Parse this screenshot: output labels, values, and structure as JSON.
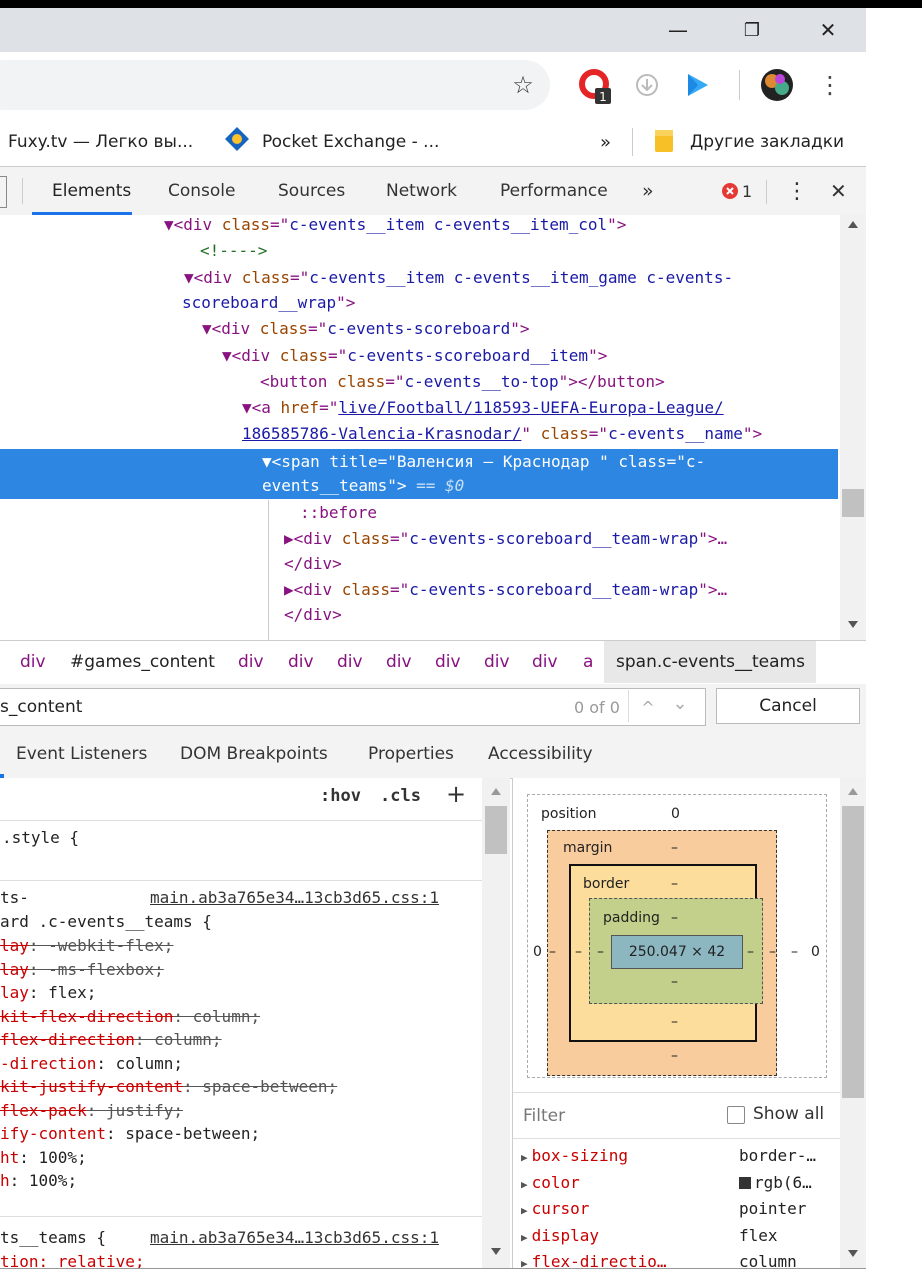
{
  "window": {
    "minimize": "—",
    "restore": "❐",
    "close": "✕"
  },
  "toolbar": {
    "star": "☆",
    "menu": "⋮",
    "ext_badge": "1"
  },
  "bookmarks": {
    "item1": "Fuxy.tv — Легко вы...",
    "item2": "Pocket Exchange - ...",
    "overflow": "»",
    "other": "Другие закладки"
  },
  "devtools": {
    "tabs": [
      "Elements",
      "Console",
      "Sources",
      "Network",
      "Performance"
    ],
    "more": "»",
    "error_count": "1",
    "menu": "⋮",
    "close": "✕"
  },
  "dom": {
    "l1": {
      "open": "▼<div ",
      "attr": "class",
      "eq": "=\"",
      "val": "c-events__item c-events__item_col",
      "close": "\">"
    },
    "l2": "<!---->",
    "l3": {
      "open": "▼<div ",
      "attr": "class",
      "eq": "=\"",
      "val": "c-events__item c-events__item_game c-events-"
    },
    "l4": {
      "val": "scoreboard__wrap",
      "close": "\">"
    },
    "l5": {
      "open": "▼<div ",
      "attr": "class",
      "eq": "=\"",
      "val": "c-events-scoreboard",
      "close": "\">"
    },
    "l6": {
      "open": "▼<div ",
      "attr": "class",
      "eq": "=\"",
      "val": "c-events-scoreboard__item",
      "close": "\">"
    },
    "l7": {
      "open": "<button ",
      "attr": "class",
      "eq": "=\"",
      "val": "c-events__to-top",
      "close": "\"></button>"
    },
    "l8": {
      "open": "▼<a ",
      "attr": "href",
      "eq": "=\"",
      "link": "live/Football/118593-UEFA-Europa-League/"
    },
    "l9": {
      "link": "186585786-Valencia-Krasnodar/",
      "q": "\" ",
      "attr": "class",
      "eq": "=\"",
      "val": "c-events__name",
      "close": "\">"
    },
    "l10": "▼<span title=\"Валенсия — Краснодар  \" class=\"c-",
    "l11a": "events__teams\">",
    "l11b": " == $0",
    "l12": "::before",
    "l13": {
      "open": "▶<div ",
      "attr": "class",
      "eq": "=\"",
      "val": "c-events-scoreboard__team-wrap",
      "close": "\">…"
    },
    "l14": "</div>",
    "l15": {
      "open": "▶<div ",
      "attr": "class",
      "eq": "=\"",
      "val": "c-events-scoreboard__team-wrap",
      "close": "\">…"
    },
    "l16": "</div>"
  },
  "breadcrumbs": [
    "div",
    "#games_content",
    "div",
    "div",
    "div",
    "div",
    "div",
    "div",
    "div",
    "a",
    "span.c-events__teams"
  ],
  "find": {
    "value": "s_content",
    "count": "0 of 0",
    "up": "^",
    "down": "⌄",
    "cancel": "Cancel"
  },
  "subtabs": [
    "Event Listeners",
    "DOM Breakpoints",
    "Properties",
    "Accessibility"
  ],
  "styles": {
    "hov": ":hov",
    "cls": ".cls",
    "plus": "+",
    "element_style": ".style {",
    "rule1_sel_a": "ts-",
    "rule1_src": "main.ab3a765e34…13cb3d65.css:1",
    "rule1_sel_b": "ard .c-events__teams {",
    "decls": [
      {
        "p": "lay",
        "v": ": -webkit-flex;",
        "strike": true
      },
      {
        "p": "lay",
        "v": ": -ms-flexbox;",
        "strike": true
      },
      {
        "p": "lay",
        "v": ": flex;",
        "strike": false
      },
      {
        "p": "kit-flex-direction",
        "v": ": column;",
        "strike": true
      },
      {
        "p": "flex-direction",
        "v": ": column;",
        "strike": true
      },
      {
        "p": "-direction",
        "v": ": column;",
        "strike": false
      },
      {
        "p": "kit-justify-content",
        "v": ": space-between;",
        "strike": true
      },
      {
        "p": "flex-pack",
        "v": ": justify;",
        "strike": true
      },
      {
        "p": "ify-content",
        "v": ": space-between;",
        "strike": false
      },
      {
        "p": "ht",
        "v": ": 100%;",
        "strike": false
      },
      {
        "p": "h",
        "v": ": 100%;",
        "strike": false
      }
    ],
    "rule2_sel": "ts__teams {",
    "rule2_src": "main.ab3a765e34…13cb3d65.css:1",
    "rule2_first": "tion: relative;"
  },
  "boxmodel": {
    "position": "position",
    "position_val": "0",
    "margin": "margin",
    "border": "border",
    "padding": "padding",
    "dash": "–",
    "left": "0",
    "right": "0",
    "content": "250.047 × 42"
  },
  "computed": {
    "filter": "Filter",
    "show_all": "Show all",
    "rows": [
      {
        "prop": "box-sizing",
        "val": "border-…",
        "swatch": false
      },
      {
        "prop": "color",
        "val": "rgb(6…",
        "swatch": true
      },
      {
        "prop": "cursor",
        "val": "pointer",
        "swatch": false
      },
      {
        "prop": "display",
        "val": "flex",
        "swatch": false
      },
      {
        "prop": "flex-directio…",
        "val": "column",
        "swatch": false
      }
    ]
  },
  "colors": {
    "selection": "#2d87e2",
    "margin": "#f9cc9d",
    "border": "#fddd9b",
    "padding": "#c3d08b",
    "content": "#8cb6c0"
  }
}
